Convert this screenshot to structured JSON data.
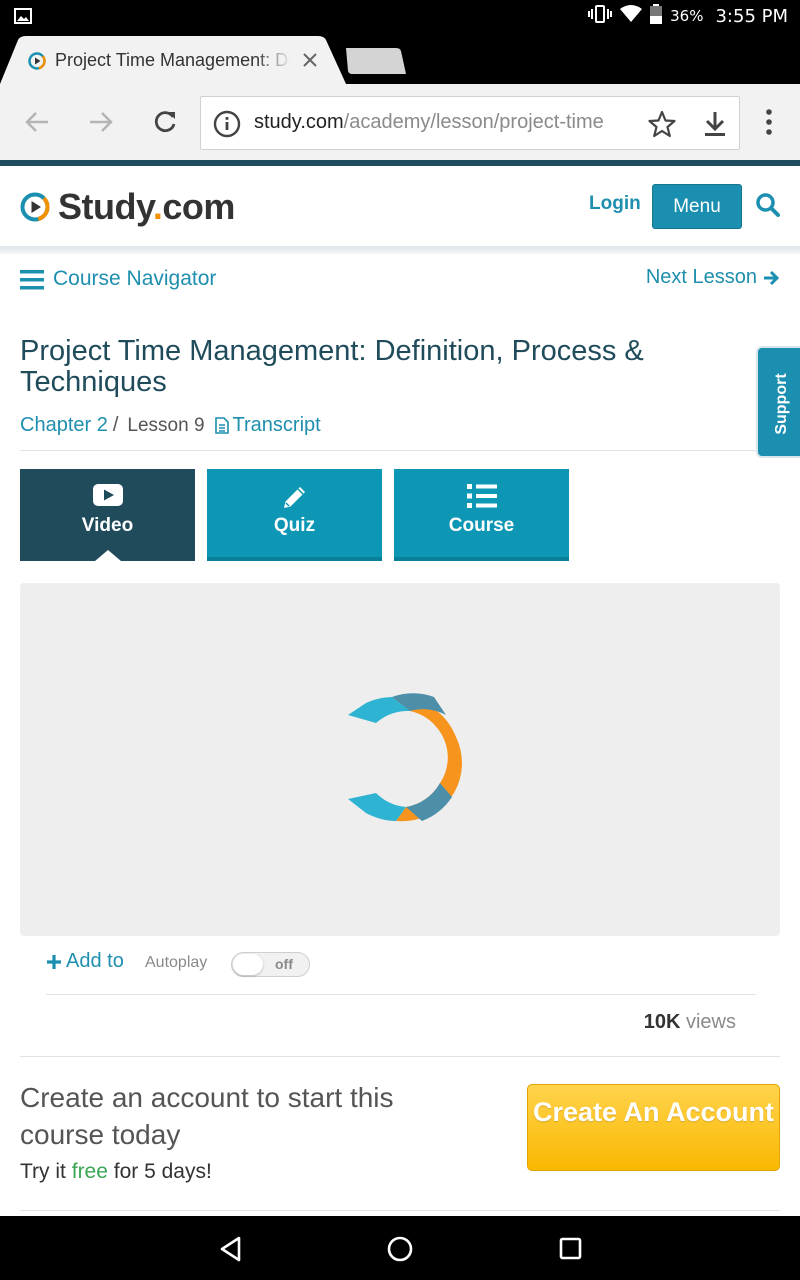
{
  "status_bar": {
    "battery": "36%",
    "time": "3:55 PM"
  },
  "browser": {
    "tab_title": "Project Time Management: Definition, Process & Techniques",
    "url_host": "study.com",
    "url_path": "/academy/lesson/project-time"
  },
  "header": {
    "logo_main": "Study",
    "logo_dot": ".",
    "logo_suffix": "com",
    "login": "Login",
    "menu": "Menu"
  },
  "nav": {
    "course_navigator": "Course Navigator",
    "next_lesson": "Next Lesson"
  },
  "lesson": {
    "title": "Project Time Management: Definition, Process & Techniques",
    "chapter": "Chapter 2",
    "separator": "/",
    "lesson_number": "Lesson 9",
    "transcript": "Transcript"
  },
  "support": "Support",
  "tabs": [
    {
      "label": "Video",
      "icon": "play-icon",
      "active": true
    },
    {
      "label": "Quiz",
      "icon": "pencil-icon",
      "active": false
    },
    {
      "label": "Course",
      "icon": "list-icon",
      "active": false
    }
  ],
  "controls": {
    "add_to": "Add to",
    "autoplay": "Autoplay",
    "toggle": "off"
  },
  "views": {
    "count": "10K",
    "label": "views"
  },
  "cta": {
    "headline": "Create an account to start this course today",
    "try_prefix": "Try it",
    "try_free": "free",
    "try_suffix": "for 5 days!",
    "button": "Create An Account"
  },
  "colors": {
    "brand_teal": "#1b8fb0",
    "dark_navy": "#1f4b5b",
    "accent_orange": "#f29100",
    "cta_yellow": "#f9b800"
  }
}
